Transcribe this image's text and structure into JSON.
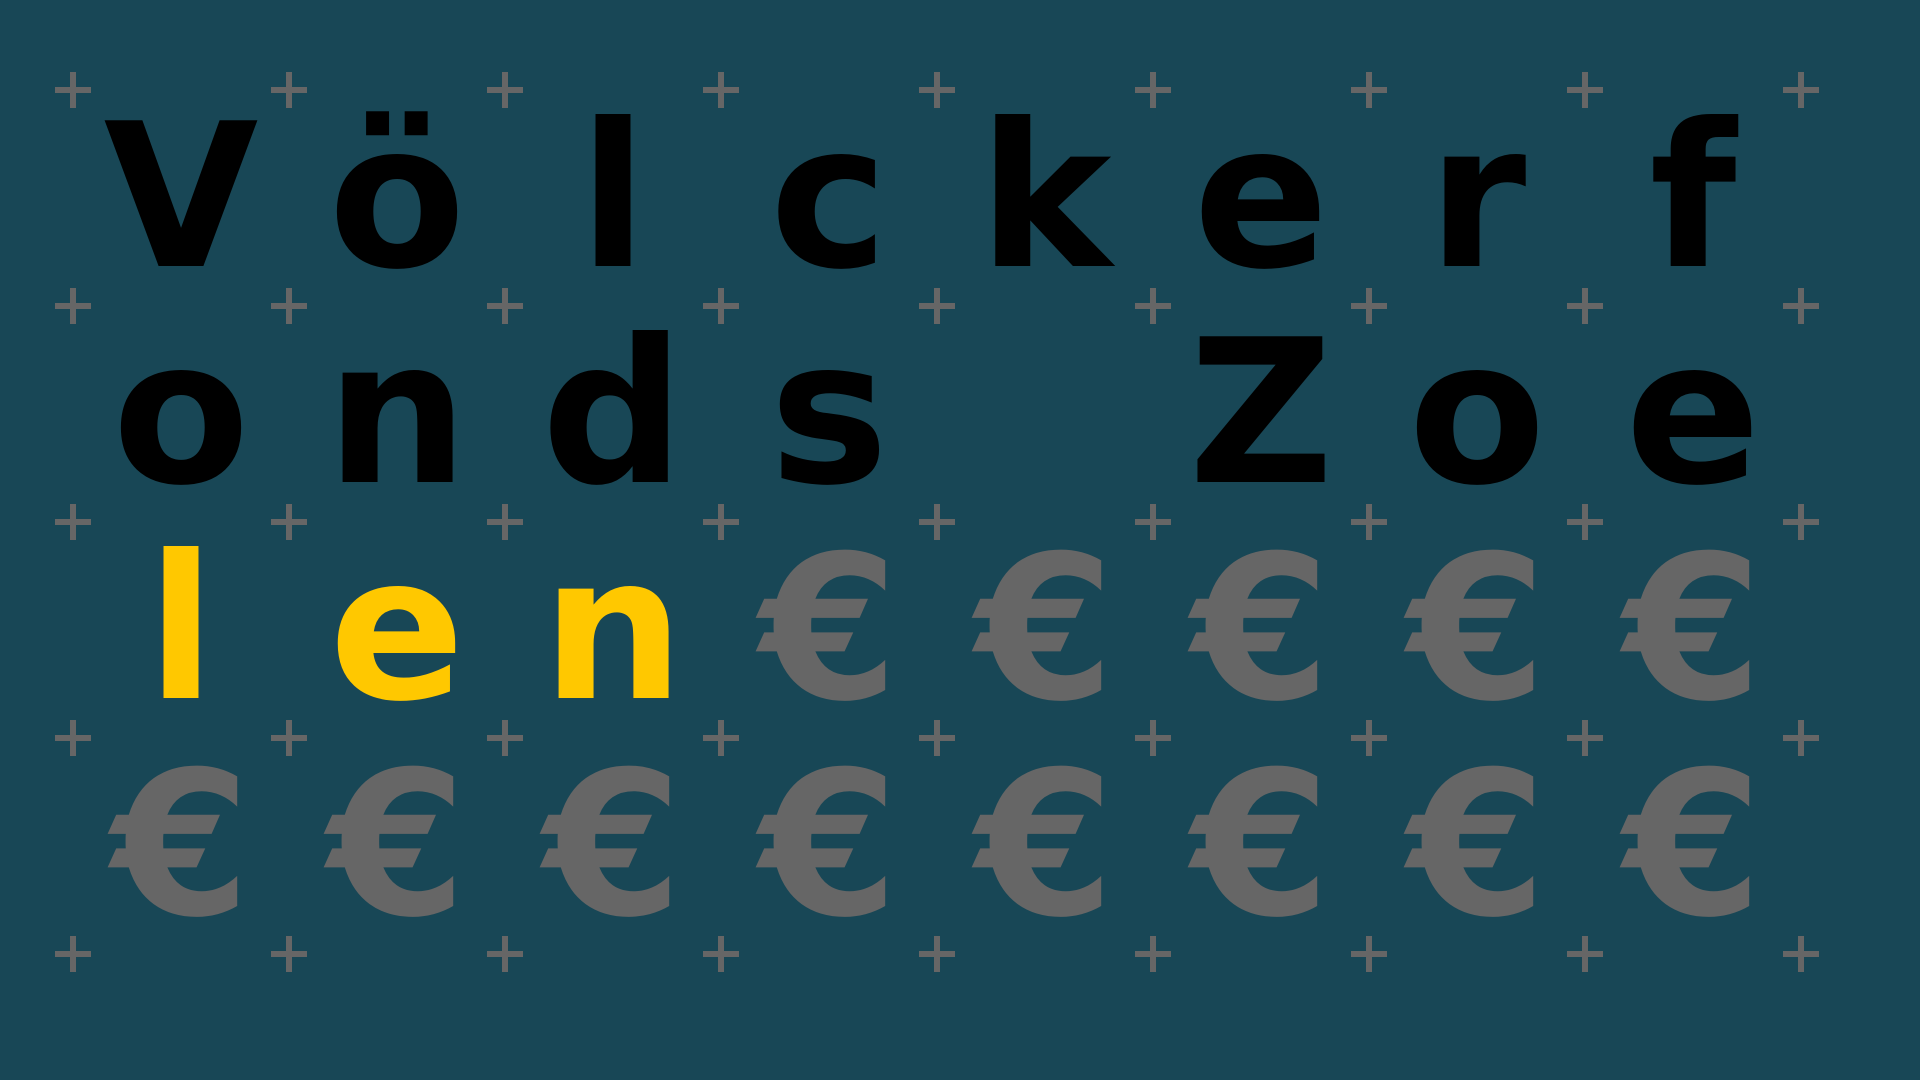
{
  "puzzle": {
    "colors": {
      "background": "#184756",
      "grid_marker": "#666666",
      "solved_letter": "#000000",
      "entered_letter": "#ffc800",
      "empty_cell": "#666666"
    },
    "empty_symbol": "€",
    "rows": [
      [
        {
          "char": "V",
          "state": "solved"
        },
        {
          "char": "ö",
          "state": "solved"
        },
        {
          "char": "l",
          "state": "solved"
        },
        {
          "char": "c",
          "state": "solved"
        },
        {
          "char": "k",
          "state": "solved"
        },
        {
          "char": "e",
          "state": "solved"
        },
        {
          "char": "r",
          "state": "solved"
        },
        {
          "char": "f",
          "state": "solved"
        }
      ],
      [
        {
          "char": "o",
          "state": "solved"
        },
        {
          "char": "n",
          "state": "solved"
        },
        {
          "char": "d",
          "state": "solved"
        },
        {
          "char": "s",
          "state": "solved"
        },
        {
          "char": "",
          "state": "blank"
        },
        {
          "char": "Z",
          "state": "solved"
        },
        {
          "char": "o",
          "state": "solved"
        },
        {
          "char": "e",
          "state": "solved"
        }
      ],
      [
        {
          "char": "l",
          "state": "entered"
        },
        {
          "char": "e",
          "state": "entered"
        },
        {
          "char": "n",
          "state": "entered"
        },
        {
          "char": "€",
          "state": "empty"
        },
        {
          "char": "€",
          "state": "empty"
        },
        {
          "char": "€",
          "state": "empty"
        },
        {
          "char": "€",
          "state": "empty"
        },
        {
          "char": "€",
          "state": "empty"
        }
      ],
      [
        {
          "char": "€",
          "state": "empty"
        },
        {
          "char": "€",
          "state": "empty"
        },
        {
          "char": "€",
          "state": "empty"
        },
        {
          "char": "€",
          "state": "empty"
        },
        {
          "char": "€",
          "state": "empty"
        },
        {
          "char": "€",
          "state": "empty"
        },
        {
          "char": "€",
          "state": "empty"
        },
        {
          "char": "€",
          "state": "empty"
        }
      ]
    ],
    "grid_marker_icon": "plus-icon"
  }
}
